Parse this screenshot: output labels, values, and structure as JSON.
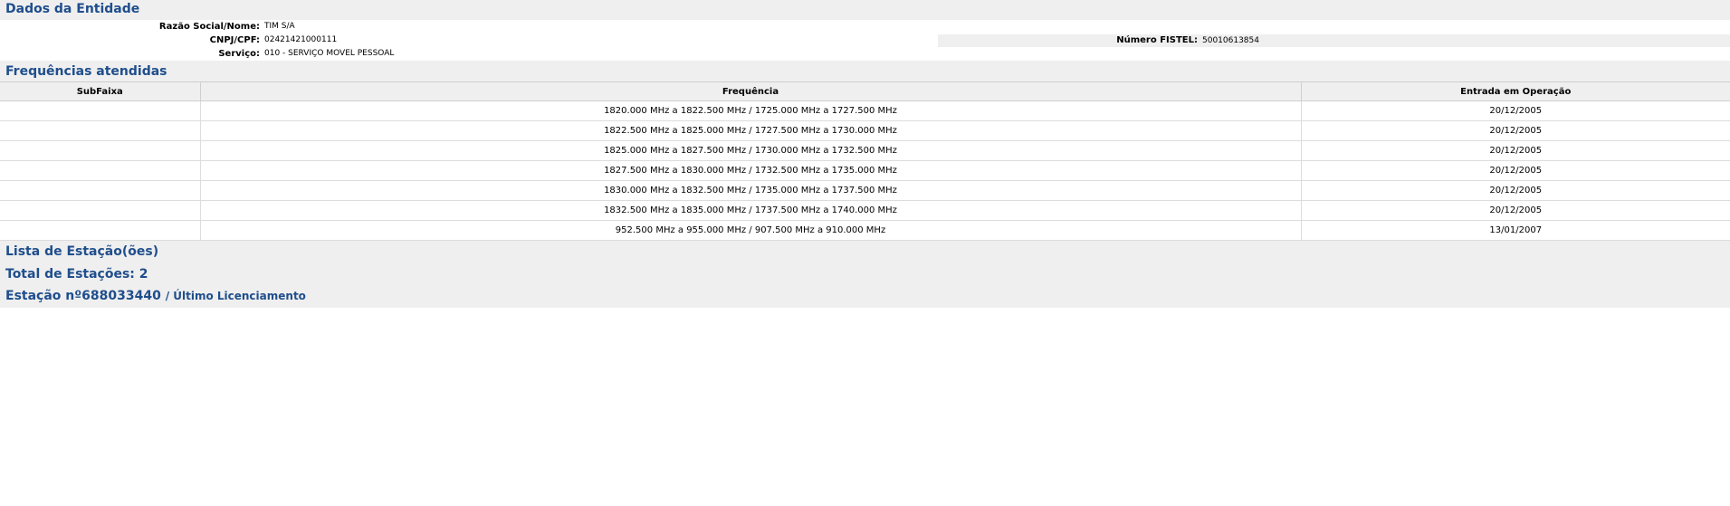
{
  "entity": {
    "section_title": "Dados da Entidade",
    "razao_label": "Razão Social/Nome:",
    "razao_value": "TIM S/A",
    "cnpj_label": "CNPJ/CPF:",
    "cnpj_value": "02421421000111",
    "servico_label": "Serviço:",
    "servico_value": "010 - SERVIÇO MOVEL PESSOAL",
    "fistel_label": "Número FISTEL:",
    "fistel_value": "50010613854"
  },
  "frequencies": {
    "section_title": "Frequências atendidas",
    "headers": [
      "SubFaixa",
      "Frequência",
      "Entrada em Operação"
    ],
    "rows": [
      {
        "subfaixa": "",
        "frequencia": "1820.000 MHz a 1822.500 MHz / 1725.000 MHz a 1727.500 MHz",
        "entrada": "20/12/2005"
      },
      {
        "subfaixa": "",
        "frequencia": "1822.500 MHz a 1825.000 MHz / 1727.500 MHz a 1730.000 MHz",
        "entrada": "20/12/2005"
      },
      {
        "subfaixa": "",
        "frequencia": "1825.000 MHz a 1827.500 MHz / 1730.000 MHz a 1732.500 MHz",
        "entrada": "20/12/2005"
      },
      {
        "subfaixa": "",
        "frequencia": "1827.500 MHz a 1830.000 MHz / 1732.500 MHz a 1735.000 MHz",
        "entrada": "20/12/2005"
      },
      {
        "subfaixa": "",
        "frequencia": "1830.000 MHz a 1832.500 MHz / 1735.000 MHz a 1737.500 MHz",
        "entrada": "20/12/2005"
      },
      {
        "subfaixa": "",
        "frequencia": "1832.500 MHz a 1835.000 MHz / 1737.500 MHz a 1740.000 MHz",
        "entrada": "20/12/2005"
      },
      {
        "subfaixa": "",
        "frequencia": "952.500 MHz a 955.000 MHz / 907.500 MHz a 910.000 MHz",
        "entrada": "13/01/2007"
      }
    ]
  },
  "stations": {
    "list_title": "Lista de Estação(ões)",
    "total_title": "Total de Estações: 2",
    "station_title": "Estação nº688033440",
    "station_link": "/ Último Licenciamento"
  }
}
